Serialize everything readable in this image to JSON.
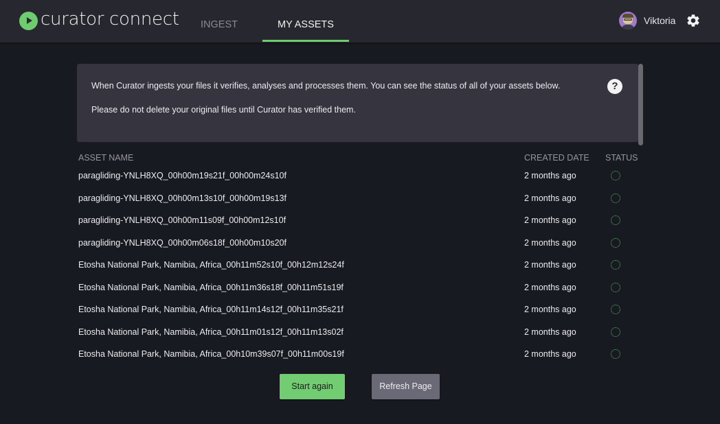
{
  "header": {
    "app_name": "curator connect",
    "tabs": [
      {
        "label": "INGEST",
        "active": false
      },
      {
        "label": "MY ASSETS",
        "active": true
      }
    ],
    "user_name": "Viktoria",
    "accent_color": "#6fcb6f"
  },
  "info": {
    "line1": "When Curator ingests your files it verifies, analyses and processes them. You can see the status of all of your assets below.",
    "line2": "Please do not delete your original files until Curator has verified them.",
    "help_icon_label": "?"
  },
  "table": {
    "columns": {
      "name": "ASSET NAME",
      "date": "CREATED DATE",
      "status": "STATUS"
    },
    "rows": [
      {
        "name": "paragliding-YNLH8XQ_00h00m19s21f_00h00m24s10f",
        "date": "2 months ago",
        "status": "processing"
      },
      {
        "name": "paragliding-YNLH8XQ_00h00m13s10f_00h00m19s13f",
        "date": "2 months ago",
        "status": "processing"
      },
      {
        "name": "paragliding-YNLH8XQ_00h00m11s09f_00h00m12s10f",
        "date": "2 months ago",
        "status": "processing"
      },
      {
        "name": "paragliding-YNLH8XQ_00h00m06s18f_00h00m10s20f",
        "date": "2 months ago",
        "status": "processing"
      },
      {
        "name": "Etosha National Park, Namibia, Africa_00h11m52s10f_00h12m12s24f",
        "date": "2 months ago",
        "status": "processing"
      },
      {
        "name": "Etosha National Park, Namibia, Africa_00h11m36s18f_00h11m51s19f",
        "date": "2 months ago",
        "status": "processing"
      },
      {
        "name": "Etosha National Park, Namibia, Africa_00h11m14s12f_00h11m35s21f",
        "date": "2 months ago",
        "status": "processing"
      },
      {
        "name": "Etosha National Park, Namibia, Africa_00h11m01s12f_00h11m13s02f",
        "date": "2 months ago",
        "status": "processing"
      },
      {
        "name": "Etosha National Park, Namibia, Africa_00h10m39s07f_00h11m00s19f",
        "date": "2 months ago",
        "status": "processing"
      }
    ]
  },
  "buttons": {
    "start_again": "Start again",
    "refresh_page": "Refresh Page"
  }
}
